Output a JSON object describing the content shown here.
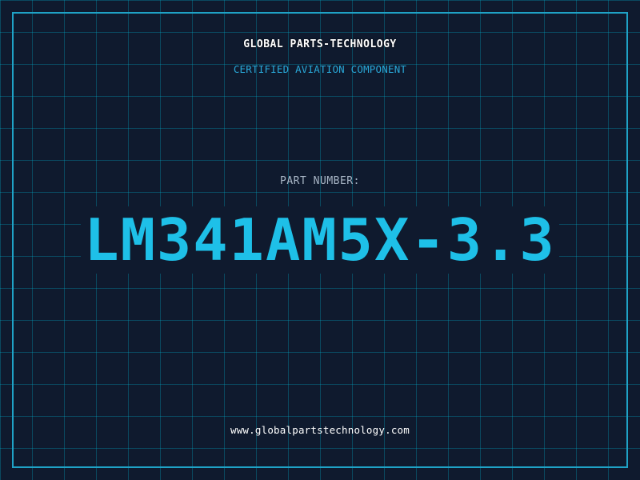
{
  "header": {
    "company_name": "GLOBAL PARTS-TECHNOLOGY",
    "subtitle": "CERTIFIED AVIATION COMPONENT"
  },
  "part": {
    "label": "PART NUMBER:",
    "number": "LM341AM5X-3.3"
  },
  "footer": {
    "website": "www.globalpartstechnology.com"
  },
  "colors": {
    "background": "#0f1a2e",
    "accent": "#1ec0e8",
    "frame": "#1fa2c6",
    "grid": "#00aac8"
  }
}
